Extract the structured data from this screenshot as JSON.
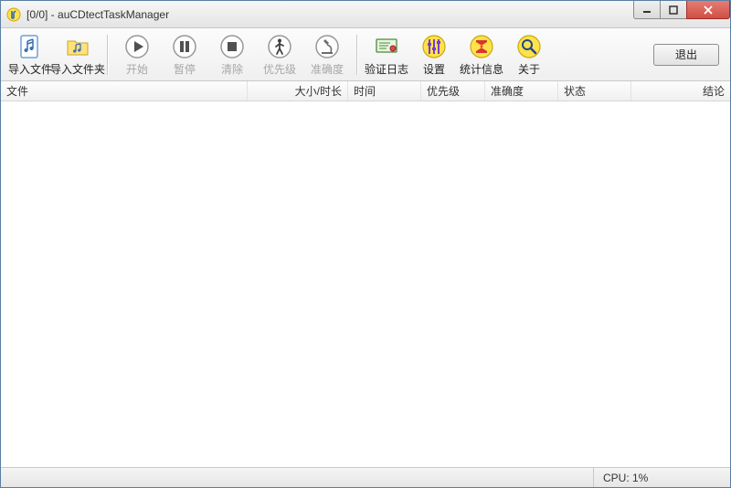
{
  "window": {
    "title": "[0/0] - auCDtectTaskManager"
  },
  "toolbar": {
    "import_file": "导入文件",
    "import_folder": "导入文件夹",
    "start": "开始",
    "pause": "暂停",
    "clear": "清除",
    "priority": "优先级",
    "accuracy": "准确度",
    "verify_log": "验证日志",
    "settings": "设置",
    "stats": "统计信息",
    "about": "关于",
    "exit": "退出"
  },
  "columns": {
    "file": "文件",
    "size_duration": "大小/时长",
    "time": "时间",
    "priority": "优先级",
    "accuracy": "准确度",
    "status": "状态",
    "result": "结论"
  },
  "status": {
    "cpu": "CPU: 1%"
  }
}
